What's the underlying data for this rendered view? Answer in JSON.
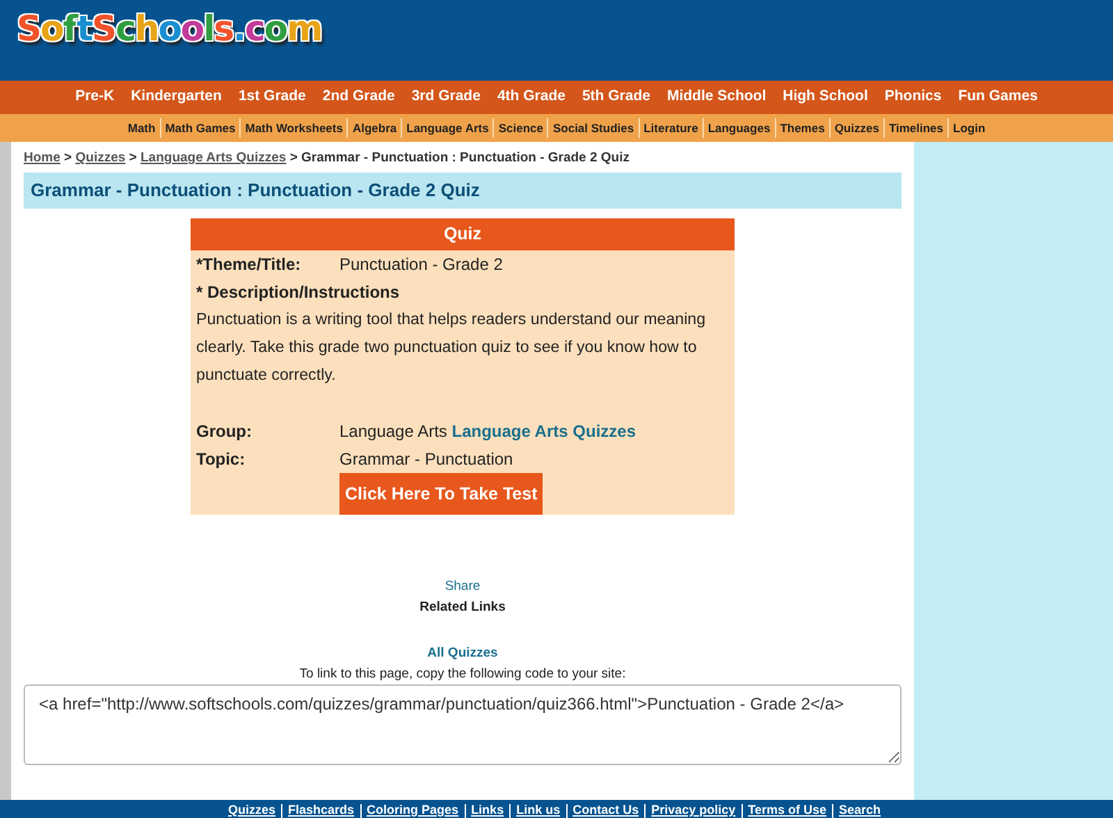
{
  "logo": "SoftSchools.com",
  "grade_nav": [
    "Pre-K",
    "Kindergarten",
    "1st Grade",
    "2nd Grade",
    "3rd Grade",
    "4th Grade",
    "5th Grade",
    "Middle School",
    "High School",
    "Phonics",
    "Fun Games"
  ],
  "subject_nav": [
    "Math",
    "Math Games",
    "Math Worksheets",
    "Algebra",
    "Language Arts",
    "Science",
    "Social Studies",
    "Literature",
    "Languages",
    "Themes",
    "Quizzes",
    "Timelines",
    "Login"
  ],
  "breadcrumb": {
    "links": [
      "Home",
      "Quizzes",
      "Language Arts Quizzes"
    ],
    "separator": ">",
    "current": "Grammar - Punctuation : Punctuation - Grade 2 Quiz"
  },
  "page_title": "Grammar - Punctuation : Punctuation - Grade 2 Quiz",
  "quiz": {
    "header": "Quiz",
    "theme_label": "*Theme/Title:",
    "theme_value": "Punctuation - Grade 2",
    "description_label": "* Description/Instructions",
    "description": "Punctuation is a writing tool that helps readers understand our meaning clearly. Take this grade two punctuation quiz to see if you know how to punctuate correctly.",
    "group_label": "Group:",
    "group_value": "Language Arts",
    "group_link": "Language Arts Quizzes",
    "topic_label": "Topic:",
    "topic_value": "Grammar - Punctuation",
    "button": "Click Here To Take Test"
  },
  "share": "Share",
  "related_links": "Related Links",
  "all_quizzes": "All Quizzes",
  "link_instructions": "To link to this page, copy the following code to your site:",
  "link_code": "<a href=\"http://www.softschools.com/quizzes/grammar/punctuation/quiz366.html\">Punctuation - Grade 2</a>",
  "footer_links": [
    "Quizzes",
    "Flashcards",
    "Coloring Pages",
    "Links",
    "Link us",
    "Contact Us",
    "Privacy policy",
    "Terms of Use",
    "Search"
  ]
}
